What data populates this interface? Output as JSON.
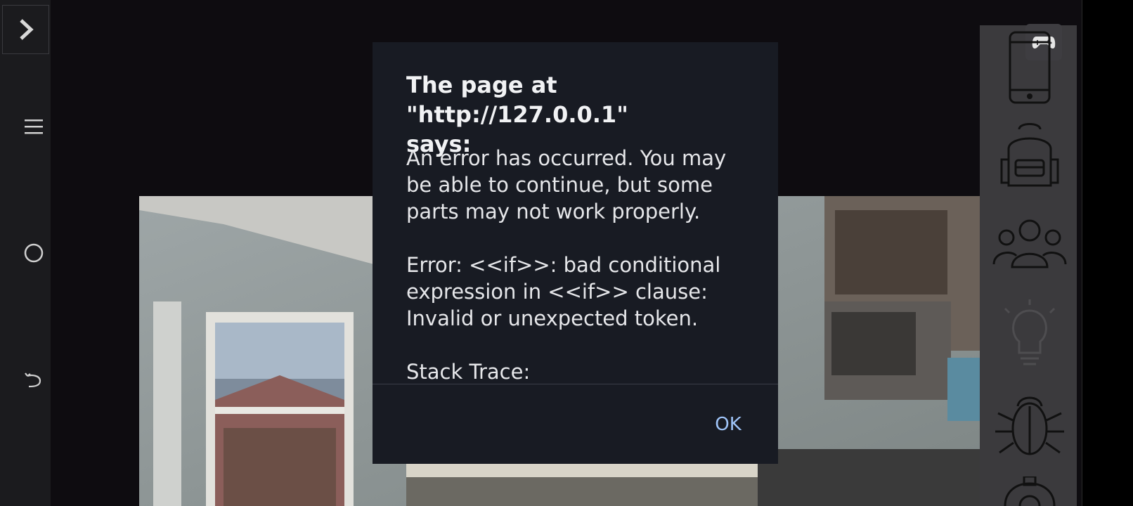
{
  "dialog": {
    "title": "The page at \"http://127.0.0.1\"\nsays:",
    "message": "An error has occurred. You may be able to continue, but some parts may not work properly.",
    "error": "Error: <<if>>: bad conditional expression in <<if>> clause: Invalid or unexpected token.",
    "stack_label": "Stack Trace:",
    "ok_label": "OK"
  },
  "icons": {
    "sidebar": [
      "chevron-right-icon",
      "menu-icon",
      "circle-icon",
      "undo-icon"
    ],
    "rightbar": [
      "gamepad-icon",
      "phone-icon",
      "backpack-icon",
      "people-icon",
      "lightbulb-icon",
      "bug-icon",
      "gear-icon"
    ]
  },
  "colors": {
    "dialog_bg": "#181b23",
    "ok_accent": "#9fc4f8",
    "sidebar_bg": "#1b1b1e",
    "rightbar_bg": "#3b3a3d"
  }
}
